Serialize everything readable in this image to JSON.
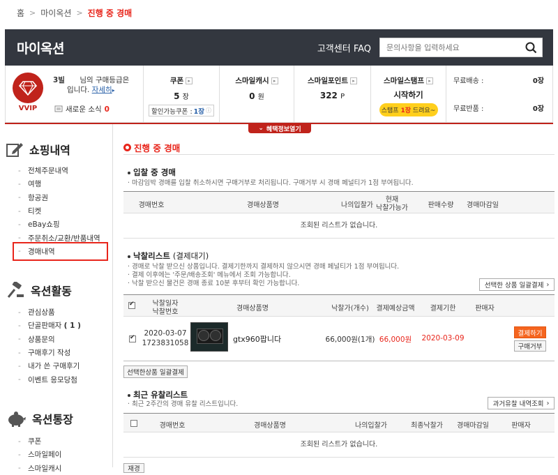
{
  "breadcrumb": {
    "home": "홈",
    "parent": "마이옥션",
    "current": "진행 중 경매",
    "sep": ">"
  },
  "header": {
    "title": "마이옥션",
    "faq": "고객센터 FAQ",
    "search_placeholder": "문의사항을 입력하세요"
  },
  "member": {
    "line1_a": "3빌",
    "line1_b": "님의 구매등급은",
    "line2": "입니다.",
    "detail_link": "자세히",
    "grade": "VVIP",
    "news_label": "새로운 소식",
    "news_count": "0"
  },
  "stats": {
    "coupon": {
      "label": "쿠폰",
      "value": "5",
      "unit": "장",
      "box_label": "할인가능쿠폰 :",
      "box_value": "1장"
    },
    "cash": {
      "label": "스마일캐시",
      "value": "0",
      "unit": "원"
    },
    "point": {
      "label": "스마일포인트",
      "value": "322",
      "unit": "P"
    },
    "stamp": {
      "label": "스마일스탬프",
      "value": "시작하기",
      "pill_a": "스탬프",
      "pill_b": "1장",
      "pill_c": "드려요~"
    },
    "free": [
      {
        "label": "무료배송 :",
        "value": "0장"
      },
      {
        "label": "무료반품 :",
        "value": "0장"
      }
    ]
  },
  "benefit_toggle": "혜택정보열기",
  "sidebar": {
    "shopping": {
      "title": "쇼핑내역",
      "items": [
        "전체주문내역",
        "여행",
        "항공권",
        "티켓",
        "eBay쇼핑",
        "주문취소/교환/반품내역",
        "경매내역"
      ]
    },
    "activity": {
      "title": "옥션활동",
      "items": [
        "관심상품",
        "단골판매자",
        "상품문의",
        "구매후기 작성",
        "내가 쓴 구매후기",
        "이벤트 응모당첨"
      ],
      "seller_count": "( 1 )"
    },
    "account": {
      "title": "옥션통장",
      "items": [
        "쿠폰",
        "스마일페이",
        "스마일캐시"
      ]
    }
  },
  "main": {
    "title": "진행 중 경매",
    "bidding": {
      "title": "입찰 중 경매",
      "note": "· 마감임박 경매를 입찰 취소하시면 구매거부로 처리됩니다. 구매거부 시 경매 페널티가 1점 부여됩니다.",
      "headers": [
        "경매번호",
        "경매상품명",
        "나의입찰가",
        "현재",
        "낙찰가능가",
        "판매수량",
        "경매마감일"
      ],
      "empty": "조회된 리스트가 없습니다."
    },
    "won": {
      "title": "낙찰리스트",
      "title_sub": "(결제대기)",
      "notes": [
        "· 경매로 낙찰 받으신 상품입니다. 결제기한까지 결제하지 않으시면 경매 페널티가 1점 부여됩니다.",
        "· 결제 이후에는 '주문/배송조회' 메뉴에서 조회 가능합니다.",
        "· 낙찰 받으신 물건은 경매 종료 10분 후부터 확인 가능합니다."
      ],
      "bulk_button": "선택한 상품 일괄결제",
      "headers": [
        "낙찰일자",
        "낙찰번호",
        "경매상품명",
        "낙찰가(개수)",
        "결제예상금액",
        "결제기한",
        "판매자"
      ],
      "rows": [
        {
          "date": "2020-03-07",
          "number": "1723831058",
          "name": "gtx960팝니다",
          "price": "66,000원(1개)",
          "expected": "66,000원",
          "deadline": "2020-03-09",
          "pay": "결제하기",
          "refuse": "구매거부"
        }
      ],
      "bulk_button_bottom": "선택한상품 일괄결제"
    },
    "failed": {
      "title": "최근 유찰리스트",
      "note": "· 최근 2주간의 경매 유찰 리스트입니다.",
      "history_button": "과거유찰 내역조회",
      "headers": [
        "경매번호",
        "경매상품명",
        "나의입찰가",
        "최종낙찰가",
        "경매마감일",
        "판매자"
      ],
      "empty": "조회된 리스트가 없습니다.",
      "next_button": "재경"
    }
  },
  "colors": {
    "accent": "#e8251b",
    "header_bg": "#33373f",
    "grade_red": "#c0231b"
  }
}
